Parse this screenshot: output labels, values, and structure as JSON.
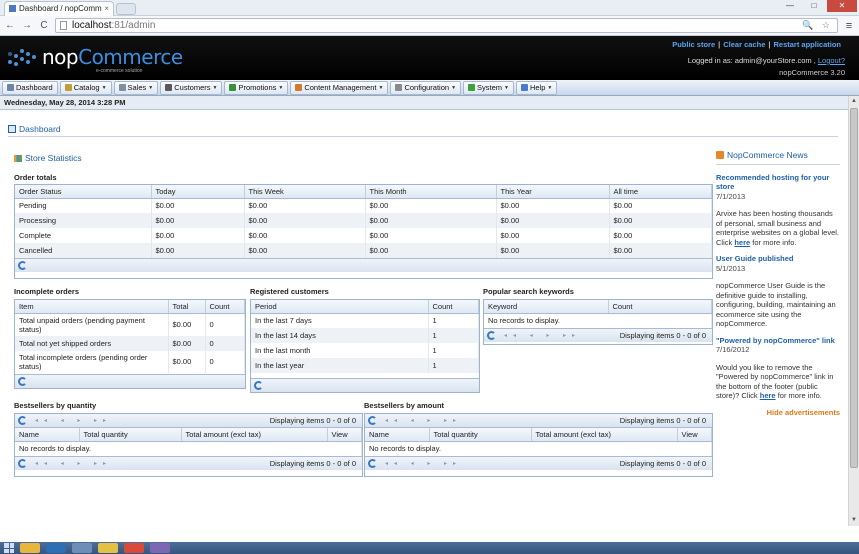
{
  "browser": {
    "tab_title": "Dashboard / nopComm",
    "tab_close": "×",
    "url_host": "localhost",
    "url_path": ":81/admin",
    "tools": "🔍 ☆",
    "nav_back": "←",
    "nav_forward": "→",
    "nav_reload": "C",
    "menu": "≡",
    "win_min": "—",
    "win_max": "□",
    "win_close": "✕"
  },
  "header": {
    "logo_name_left": "nop",
    "logo_name_right": "Commerce",
    "logo_tagline": "e-commerce solution",
    "links": [
      "Public store",
      "Clear cache",
      "Restart application"
    ],
    "logged_in_prefix": "Logged in as: admin@yourStore.com , ",
    "logout": "Logout?",
    "version": "nopCommerce 3.20"
  },
  "menu": {
    "items": [
      {
        "label": "Dashboard",
        "color": "#6d84a8",
        "caret": ""
      },
      {
        "label": "Catalog",
        "color": "#c59b3b",
        "caret": "▼"
      },
      {
        "label": "Sales",
        "color": "#7f8f9f",
        "caret": "▼"
      },
      {
        "label": "Customers",
        "color": "#5a5a5a",
        "caret": "▼"
      },
      {
        "label": "Promotions",
        "color": "#3d8f3a",
        "caret": "▼"
      },
      {
        "label": "Content Management",
        "color": "#d47a2a",
        "caret": "▼"
      },
      {
        "label": "Configuration",
        "color": "#8a8a8a",
        "caret": "▼"
      },
      {
        "label": "System",
        "color": "#3aa23a",
        "caret": "▼"
      },
      {
        "label": "Help",
        "color": "#4a7ad0",
        "caret": "▼"
      }
    ]
  },
  "date_bar": "Wednesday, May 28, 2014 3:28 PM",
  "page_title": "Dashboard",
  "stats": {
    "title": "Store Statistics",
    "order_totals": {
      "heading": "Order totals",
      "columns": [
        "Order Status",
        "Today",
        "This Week",
        "This Month",
        "This Year",
        "All time"
      ],
      "rows": [
        [
          "Pending",
          "$0.00",
          "$0.00",
          "$0.00",
          "$0.00",
          "$0.00"
        ],
        [
          "Processing",
          "$0.00",
          "$0.00",
          "$0.00",
          "$0.00",
          "$0.00"
        ],
        [
          "Complete",
          "$0.00",
          "$0.00",
          "$0.00",
          "$0.00",
          "$0.00"
        ],
        [
          "Cancelled",
          "$0.00",
          "$0.00",
          "$0.00",
          "$0.00",
          "$0.00"
        ]
      ]
    },
    "incomplete": {
      "heading": "Incomplete orders",
      "columns": [
        "Item",
        "Total",
        "Count"
      ],
      "rows": [
        [
          "Total unpaid orders (pending payment status)",
          "$0.00",
          "0"
        ],
        [
          "Total not yet shipped orders",
          "$0.00",
          "0"
        ],
        [
          "Total incomplete orders (pending order status)",
          "$0.00",
          "0"
        ]
      ]
    },
    "registered": {
      "heading": "Registered customers",
      "columns": [
        "Period",
        "Count"
      ],
      "rows": [
        [
          "In the last 7 days",
          "1"
        ],
        [
          "In the last 14 days",
          "1"
        ],
        [
          "In the last month",
          "1"
        ],
        [
          "In the last year",
          "1"
        ]
      ]
    },
    "keywords": {
      "heading": "Popular search keywords",
      "columns": [
        "Keyword",
        "Count"
      ],
      "empty": "No records to display.",
      "display": "Displaying items 0 - 0 of 0"
    },
    "bestsellers_qty": {
      "heading": "Bestsellers by quantity",
      "columns": [
        "Name",
        "Total quantity",
        "Total amount (excl tax)",
        "View"
      ],
      "empty": "No records to display.",
      "display": "Displaying items 0 - 0 of 0"
    },
    "bestsellers_amount": {
      "heading": "Bestsellers by amount",
      "columns": [
        "Name",
        "Total quantity",
        "Total amount (excl tax)",
        "View"
      ],
      "empty": "No records to display.",
      "display": "Displaying items 0 - 0 of 0"
    },
    "pager_glyphs": "◂◂ ◂ ▸ ▸▸"
  },
  "news": {
    "title": "NopCommerce News",
    "items": [
      {
        "title": "Recommended hosting for your store",
        "date": "7/1/2013",
        "body": "Arvixe has been hosting thousands of personal, small business and enterprise websites on a global level. Click ",
        "link": "here",
        "after": " for more info."
      },
      {
        "title": "User Guide published",
        "date": "5/1/2013",
        "body": "nopCommerce User Guide is the definitive guide to installing, configuring, building, maintaining an ecommerce site using the nopCommerce.",
        "link": "",
        "after": ""
      },
      {
        "title": "\"Powered by nopCommerce\" link",
        "date": "7/16/2012",
        "body": "Would you like to remove the \"Powered by nopCommerce\" link in the bottom of the footer (public store)? Click ",
        "link": "here",
        "after": " for more info."
      }
    ],
    "hide_ads": "Hide advertisements"
  }
}
